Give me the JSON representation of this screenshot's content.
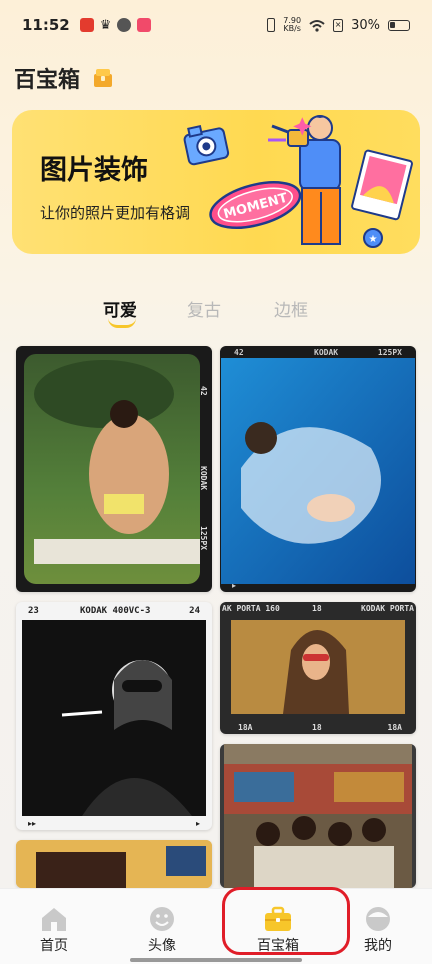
{
  "status_bar": {
    "time": "11:52",
    "speed_value": "7.90",
    "speed_unit": "KB/s",
    "battery": "30%",
    "icons": [
      "app-red-icon",
      "crown-icon",
      "check-circle-icon",
      "app-pink-icon",
      "vibrate-icon",
      "wifi-icon",
      "no-sim-icon",
      "battery-icon"
    ]
  },
  "header": {
    "title": "百宝箱",
    "icon": "treasure-chest-icon"
  },
  "banner": {
    "title": "图片装饰",
    "subtitle": "让你的照片更加有格调",
    "sticker_text": "MOMENT",
    "accent": "#ffd951"
  },
  "tabs": [
    {
      "label": "可爱",
      "active": true
    },
    {
      "label": "复古",
      "active": false
    },
    {
      "label": "边框",
      "active": false
    }
  ],
  "gallery": [
    {
      "frame_top": "",
      "frame_side_a": "42",
      "frame_side_b": "KODAK",
      "frame_side_c": "125PX"
    },
    {
      "frame_top_left": "42",
      "frame_top_mid": "KODAK",
      "frame_top_right": "125PX"
    },
    {
      "frame_top_left": "23",
      "frame_top_mid": "KODAK 400VC-3",
      "frame_top_right": "24"
    },
    {
      "frame_top_left": "AK PORTA 160",
      "frame_top_mid": "18",
      "frame_top_right": "KODAK PORTA",
      "frame_bottom_left": "18A",
      "frame_bottom_mid": "18",
      "frame_bottom_right": "18A"
    },
    {},
    {}
  ],
  "bottom_nav": [
    {
      "label": "首页",
      "icon": "home-icon",
      "active": false
    },
    {
      "label": "头像",
      "icon": "smiley-icon",
      "active": false
    },
    {
      "label": "百宝箱",
      "icon": "toolbox-icon",
      "active": true
    },
    {
      "label": "我的",
      "icon": "profile-icon",
      "active": false
    }
  ],
  "colors": {
    "accent_yellow": "#f7c62a",
    "highlight_red": "#e01d28"
  }
}
